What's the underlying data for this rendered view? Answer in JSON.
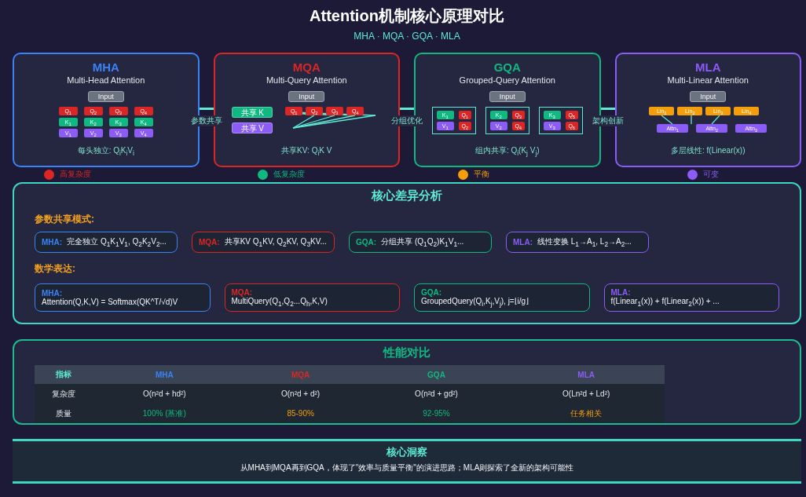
{
  "title": "Attention机制核心原理对比",
  "subtitle": "MHA · MQA · GQA · MLA",
  "cards": [
    {
      "kind": "mha",
      "abbr": "MHA",
      "name": "Multi-Head Attention",
      "color": "#3b82f6",
      "input": "Input",
      "heads": [
        {
          "q": "Q$_{1}$",
          "k": "K$_{1}$",
          "v": "V$_{1}$"
        },
        {
          "q": "Q$_{2}$",
          "k": "K$_{2}$",
          "v": "V$_{2}$"
        },
        {
          "q": "Q$_{3}$",
          "k": "K$_{3}$",
          "v": "V$_{3}$"
        },
        {
          "q": "Q$_{4}$",
          "k": "K$_{4}$",
          "v": "V$_{4}$"
        }
      ],
      "formula": "每头独立: Q$_{i}$K$_{i}$V$_{i}$",
      "complexity": {
        "label": "高复杂度",
        "color": "#dc2626"
      }
    },
    {
      "kind": "mqa",
      "abbr": "MQA",
      "name": "Multi-Query Attention",
      "color": "#dc2626",
      "input": "Input",
      "shared_k": "共享 K",
      "shared_v": "共享 V",
      "queries": [
        "Q$_{1}$",
        "Q$_{2}$",
        "Q$_{3}$",
        "Q$_{4}$"
      ],
      "formula": "共享KV: Q$_{i}$K V",
      "complexity": {
        "label": "低复杂度",
        "color": "#10b981"
      }
    },
    {
      "kind": "gqa",
      "abbr": "GQA",
      "name": "Grouped-Query Attention",
      "color": "#10b981",
      "input": "Input",
      "groups": [
        {
          "k": "K$_{1}$",
          "v": "V$_{1}$",
          "q": [
            "Q$_{1}$",
            "Q$_{2}$"
          ]
        },
        {
          "k": "K$_{2}$",
          "v": "V$_{2}$",
          "q": [
            "Q$_{3}$",
            "Q$_{4}$"
          ]
        },
        {
          "k": "K$_{3}$",
          "v": "V$_{3}$",
          "q": [
            "Q$_{5}$",
            "Q$_{6}$"
          ]
        }
      ],
      "formula": "组内共享: Q$_{i}$(K$_{j}$ V$_{j}$)",
      "complexity": {
        "label": "平衡",
        "color": "#f59e0b"
      }
    },
    {
      "kind": "mla",
      "abbr": "MLA",
      "name": "Multi-Linear Attention",
      "color": "#8b5cf6",
      "input": "Input",
      "lins": [
        "Lin$_{1}$",
        "Lin$_{2}$",
        "Lin$_{3}$",
        "Lin$_{4}$"
      ],
      "attns": [
        "Attn$_{1}$",
        "Attn$_{2}$",
        "Attn$_{3}$"
      ],
      "formula": "多层线性: f(Linear(x))",
      "complexity": {
        "label": "可变",
        "color": "#8b5cf6"
      }
    }
  ],
  "connectors": [
    "参数共享",
    "分组优化",
    "架构创新"
  ],
  "analysis": {
    "title": "核心差异分析",
    "sections": [
      {
        "kind": "inline",
        "heading": "参数共享模式:",
        "items": [
          {
            "tag": "MHA:",
            "text": "完全独立 Q$_{1}$K$_{1}$V$_{1}$, Q$_{2}$K$_{2}$V$_{2}$...",
            "color": "#3b82f6"
          },
          {
            "tag": "MQA:",
            "text": "共享KV Q$_{1}$KV, Q$_{2}$KV, Q$_{3}$KV...",
            "color": "#dc2626"
          },
          {
            "tag": "GQA:",
            "text": "分组共享 (Q$_{1}$Q$_{2}$)K$_{1}$V$_{1}$...",
            "color": "#10b981"
          },
          {
            "tag": "MLA:",
            "text": "线性变换 L$_{1}$→A$_{1}$, L$_{2}$→A$_{2}$...",
            "color": "#8b5cf6"
          }
        ]
      },
      {
        "kind": "stacked",
        "heading": "数学表达:",
        "items": [
          {
            "tag": "MHA:",
            "text": "Attention(Q,K,V) = Softmax(QK^T/√d)V",
            "color": "#3b82f6"
          },
          {
            "tag": "MQA:",
            "text": "MultiQuery(Q$_{1}$,Q$_{2}$...Q$_{h}$,K,V)",
            "color": "#dc2626"
          },
          {
            "tag": "GQA:",
            "text": "GroupedQuery(Q$_{i}$,K$_{j}$,V$_{j}$), j=⌊i/g⌋",
            "color": "#10b981"
          },
          {
            "tag": "MLA:",
            "text": "f(Linear$_{1}$(x)) + f(Linear$_{2}$(x)) + ...",
            "color": "#8b5cf6"
          }
        ]
      }
    ]
  },
  "performance": {
    "title": "性能对比",
    "columns": [
      "指标",
      "MHA",
      "MQA",
      "GQA",
      "MLA"
    ],
    "rows": [
      [
        {
          "text": "复杂度",
          "kind": "plain"
        },
        {
          "text": "O(n²d + hd²)",
          "kind": "plain"
        },
        {
          "text": "O(n²d + d²)",
          "kind": "plain"
        },
        {
          "text": "O(n²d + gd²)",
          "kind": "plain"
        },
        {
          "text": "O(Ln²d + Ld²)",
          "kind": "plain"
        }
      ],
      [
        {
          "text": "质量",
          "kind": "plain"
        },
        {
          "text": "100% (基准)",
          "kind": "good"
        },
        {
          "text": "85-90%",
          "kind": "caution"
        },
        {
          "text": "92-95%",
          "kind": "good"
        },
        {
          "text": "任务相关",
          "kind": "caution"
        }
      ]
    ]
  },
  "insight": {
    "title": "核心洞察",
    "text": "从MHA到MQA再到GQA，体现了\"效率与质量平衡\"的演进思路；MLA则探索了全新的架构可能性"
  }
}
